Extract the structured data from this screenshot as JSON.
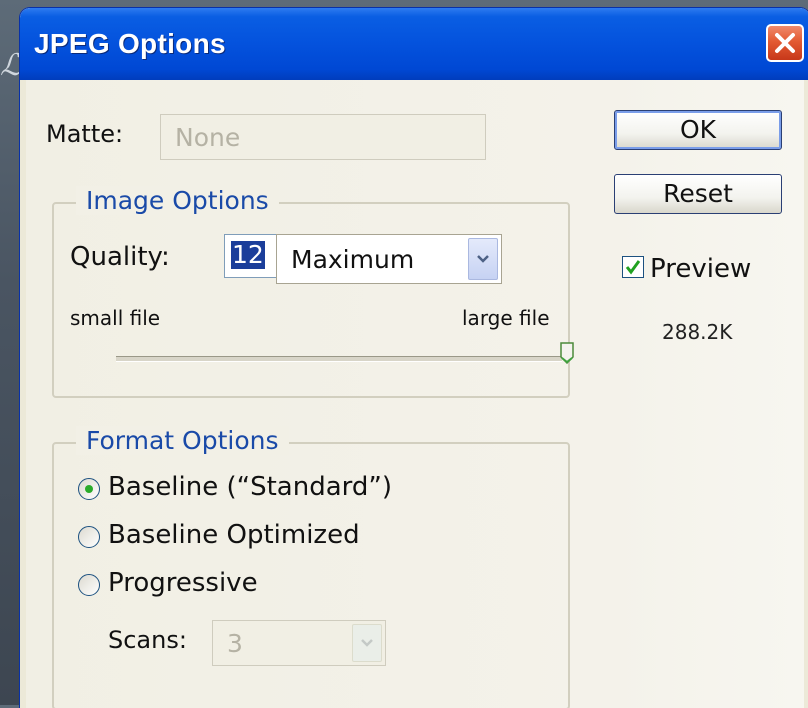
{
  "background": {
    "glyph": "ℒ"
  },
  "dialog": {
    "title": "JPEG Options",
    "matte": {
      "label": "Matte:",
      "value": "None"
    },
    "image_options": {
      "title": "Image Options",
      "quality_label": "Quality:",
      "quality_value": "12",
      "quality_preset": "Maximum",
      "small_file_label": "small file",
      "large_file_label": "large file",
      "slider_position": 1.0
    },
    "format_options": {
      "title": "Format Options",
      "options": [
        {
          "label": "Baseline (“Standard”)",
          "selected": true
        },
        {
          "label": "Baseline Optimized",
          "selected": false
        },
        {
          "label": "Progressive",
          "selected": false
        }
      ],
      "scans": {
        "label": "Scans:",
        "value": "3"
      }
    },
    "buttons": {
      "ok": "OK",
      "reset": "Reset"
    },
    "preview": {
      "label": "Preview",
      "checked": true
    },
    "file_size": "288.2K"
  },
  "colors": {
    "titlebar": "#0452dd",
    "dialog_bg": "#ece9d8",
    "group_title": "#1a4aa8",
    "radio_dot": "#2aab2a"
  }
}
